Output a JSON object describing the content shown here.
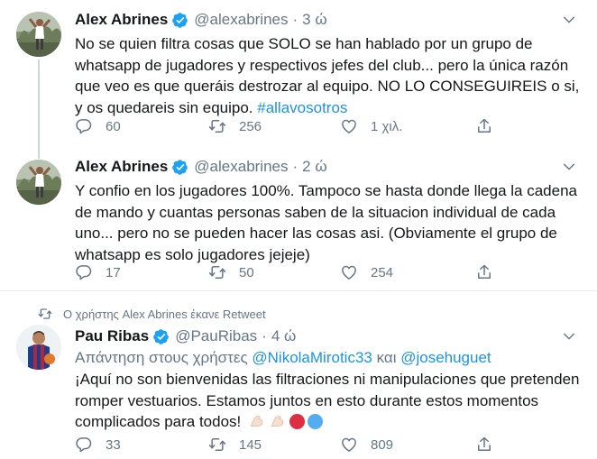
{
  "tweets": [
    {
      "name": "Alex Abrines",
      "handle": "@alexabrines",
      "dot": "·",
      "time": "3 ώ",
      "text_before": "No se quien filtra cosas que SOLO se han hablado por un grupo de whatsapp de jugadores y respectivos jefes del club... pero la única razón que veo es que queráis destrozar al equipo. NO LO CONSEGUIREIS o si, y os quedareis sin equipo. ",
      "hashtag": "#allavosotros",
      "replies": "60",
      "retweets": "256",
      "likes": "1 χιλ."
    },
    {
      "name": "Alex Abrines",
      "handle": "@alexabrines",
      "dot": "·",
      "time": "2 ώ",
      "text": "Y confio en los jugadores 100%. Tampoco se hasta donde llega la cadena de mando y cuantas personas saben de la situacion individual de cada uno... pero no se pueden hacer las cosas asi. (Obviamente el grupo de whatsapp es solo jugadores jejeje)",
      "replies": "17",
      "retweets": "50",
      "likes": "254"
    },
    {
      "retweet_context": "Ο χρήστης Alex Abrines έκανε Retweet",
      "name": "Pau Ribas",
      "handle": "@PauRibas",
      "dot": "·",
      "time": "4 ώ",
      "replying_prefix": "Απάντηση στους χρήστες ",
      "replying_mention_1": "@NikolaMirotic33",
      "replying_joiner": " και ",
      "replying_mention_2": "@josehuguet",
      "text": "¡Aquí no son bienvenidas las filtraciones ni manipulaciones que pretenden romper vestuarios. Estamos juntos en esto durante estos momentos complicados para todos!",
      "emojis": [
        "flexed-biceps",
        "flexed-biceps",
        "red-circle",
        "blue-circle"
      ],
      "replies": "33",
      "retweets": "145",
      "likes": "809"
    }
  ],
  "colors": {
    "text": "#14171a",
    "secondary": "#657786",
    "link": "#1b95e0",
    "verified": "#1da1f2",
    "divider": "#e6ecf0",
    "red_circle": "#dd2e44",
    "blue_circle": "#55acee"
  },
  "icons": [
    "verified-badge-icon",
    "chevron-down-icon",
    "reply-icon",
    "retweet-icon",
    "like-icon",
    "share-icon"
  ]
}
